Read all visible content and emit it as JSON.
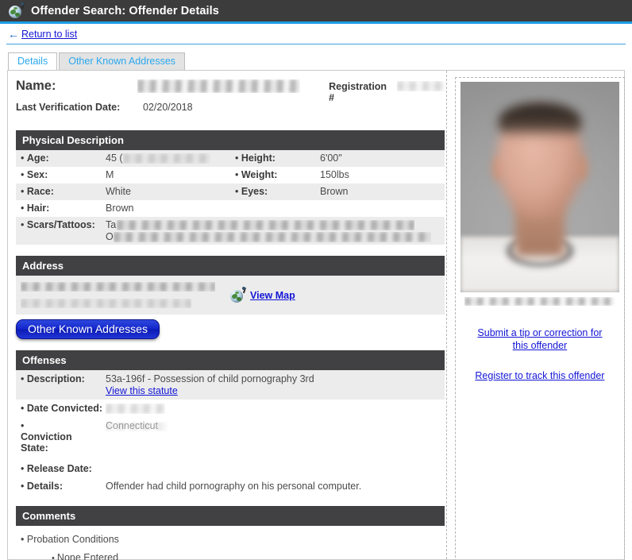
{
  "titlebar": {
    "title": "Offender Search: Offender Details",
    "icon": "globe-icon"
  },
  "nav": {
    "return_link": "Return to list",
    "back_arrow": "←"
  },
  "tabs": [
    {
      "label": "Details",
      "active": true
    },
    {
      "label": "Other Known Addresses",
      "active": false
    }
  ],
  "identity": {
    "name_label": "Name:",
    "name_value": "",
    "registration_label": "Registration #",
    "registration_value": "",
    "last_verification_label": "Last Verification Date:",
    "last_verification_value": "02/20/2018"
  },
  "physical_description": {
    "heading": "Physical Description",
    "rows": [
      {
        "left_label": "Age:",
        "left_value": "45 (",
        "left_redacted": true,
        "right_label": "Height:",
        "right_value": "6'00\""
      },
      {
        "left_label": "Sex:",
        "left_value": "M",
        "right_label": "Weight:",
        "right_value": "150lbs"
      },
      {
        "left_label": "Race:",
        "left_value": "White",
        "right_label": "Eyes:",
        "right_value": "Brown"
      },
      {
        "left_label": "Hair:",
        "left_value": "Brown",
        "right_label": "",
        "right_value": ""
      }
    ],
    "scars_label": "Scars/Tattoos:",
    "scars_value_line1": "Ta",
    "scars_value_line1_tail": "oss &",
    "scars_value_line2": "O",
    "scars_redacted": true
  },
  "address": {
    "heading": "Address",
    "line1": "",
    "line2": "County",
    "redacted": true,
    "view_map_label": "View Map",
    "view_map_icon": "globe-icon",
    "other_addresses_button": "Other Known Addresses"
  },
  "offenses": {
    "heading": "Offenses",
    "rows": [
      {
        "label": "Description:",
        "value": "53a-196f - Possession of child pornography 3rd",
        "link": "View this statute"
      },
      {
        "label": "Date Convicted:",
        "value": "",
        "redacted": true
      },
      {
        "label": "Conviction State:",
        "value": "Connecticut",
        "redacted": true
      },
      {
        "label": "Release Date:",
        "value": ""
      },
      {
        "label": "Details:",
        "value": "Offender had child pornography on his personal computer."
      }
    ]
  },
  "comments": {
    "heading": "Comments",
    "items": [
      {
        "text": "Probation Conditions",
        "children": [
          "None Entered"
        ]
      }
    ]
  },
  "sidebar": {
    "photo_alt": "offender-photo",
    "photo_caption": "",
    "links": [
      "Submit a tip or correction for this offender",
      "Register to track this offender"
    ]
  },
  "colors": {
    "titlebar_bg": "#3d3c3c",
    "accent_blue": "#1c9ee6",
    "section_header_bg": "#414042",
    "link_blue": "#1316d6",
    "tab_text": "#29a8ef",
    "row_stripe": "#ececec",
    "button_blue": "#1326cc"
  }
}
